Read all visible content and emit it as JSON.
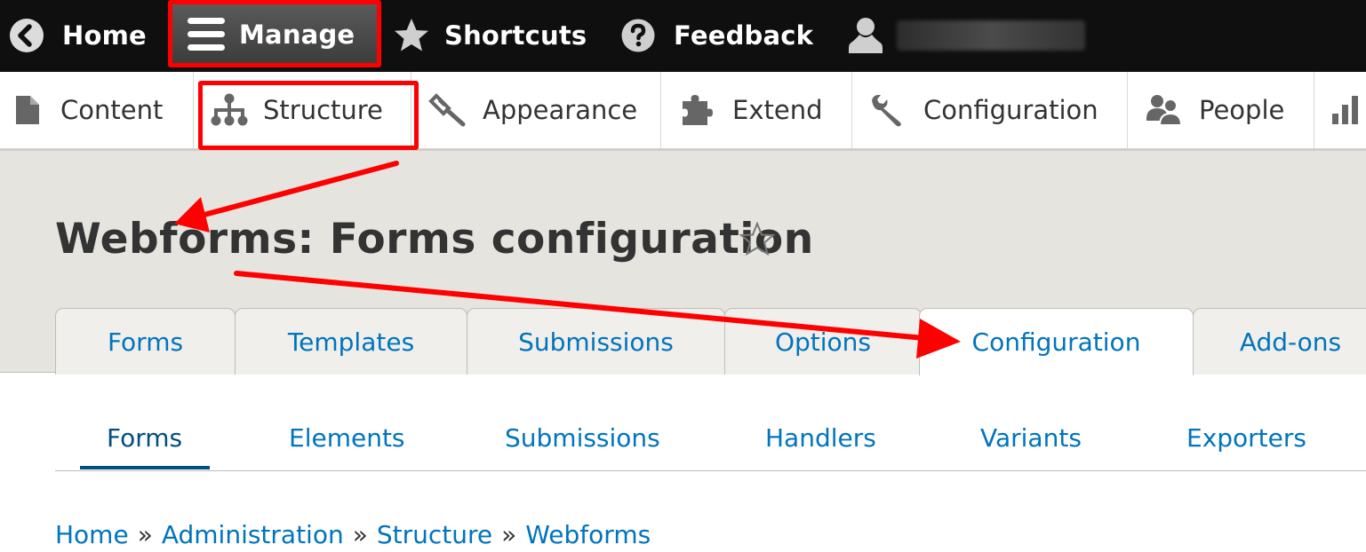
{
  "toolbar": {
    "home": {
      "label": "Home",
      "icon": "chevron-left-circle-icon"
    },
    "manage": {
      "label": "Manage",
      "icon": "hamburger-menu-icon"
    },
    "shortcuts": {
      "label": "Shortcuts",
      "icon": "star-icon"
    },
    "feedback": {
      "label": "Feedback",
      "icon": "question-circle-icon"
    },
    "user": {
      "icon": "user-icon"
    }
  },
  "tray": {
    "items": [
      {
        "label": "Content",
        "icon": "document-icon"
      },
      {
        "label": "Structure",
        "icon": "sitemap-icon"
      },
      {
        "label": "Appearance",
        "icon": "paintbrush-icon"
      },
      {
        "label": "Extend",
        "icon": "puzzle-icon"
      },
      {
        "label": "Configuration",
        "icon": "wrench-icon"
      },
      {
        "label": "People",
        "icon": "people-icon"
      },
      {
        "label": "",
        "icon": "bar-chart-icon"
      }
    ]
  },
  "header": {
    "title": "Webforms: Forms configuration",
    "tabs": [
      "Forms",
      "Templates",
      "Submissions",
      "Options",
      "Configuration",
      "Add-ons"
    ],
    "active_tab": "Configuration"
  },
  "subtabs": {
    "items": [
      "Forms",
      "Elements",
      "Submissions",
      "Handlers",
      "Variants",
      "Exporters"
    ],
    "active": "Forms"
  },
  "breadcrumb": {
    "items": [
      "Home",
      "Administration",
      "Structure",
      "Webforms"
    ],
    "separator": "»"
  },
  "colors": {
    "toolbar_bg": "#0f0f0f",
    "link": "#0074bd",
    "header_bg": "#e6e4df",
    "annotation": "#ff0000"
  }
}
